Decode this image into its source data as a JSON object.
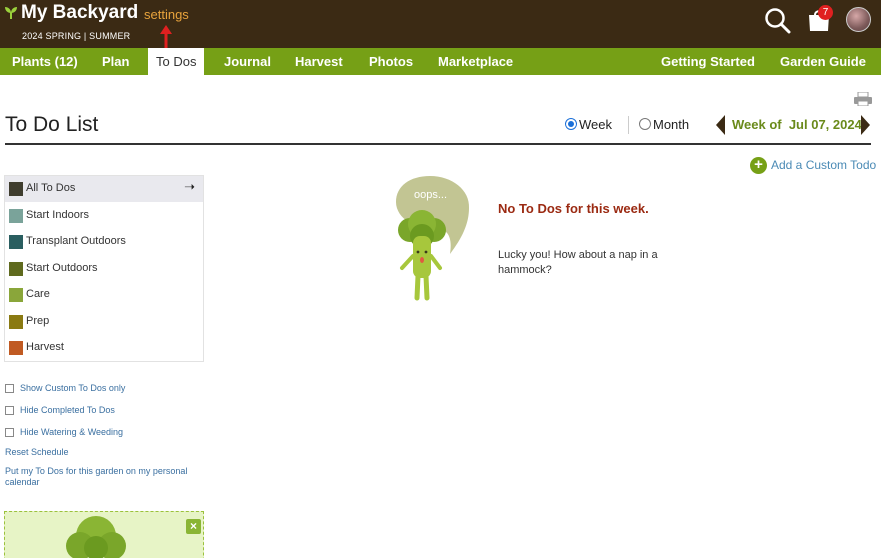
{
  "header": {
    "app_title": "My Backyard",
    "settings_label": "settings",
    "season": "2024 SPRING | SUMMER",
    "cart_count": "7",
    "icons": {
      "logo": "sprout-icon",
      "search": "search-icon",
      "cart": "shopping-bag-icon",
      "avatar": "user-avatar"
    }
  },
  "nav": {
    "items": [
      "Plants (12)",
      "Plan",
      "To Dos",
      "Journal",
      "Harvest",
      "Photos",
      "Marketplace"
    ],
    "right_items": [
      "Getting Started",
      "Garden Guide"
    ],
    "active": "To Dos"
  },
  "page": {
    "title": "To Do List",
    "view_options": [
      "Week",
      "Month"
    ],
    "selected_view": "Week",
    "week_label": "Week of  Jul 07, 2024",
    "add_custom_label": "Add a Custom Todo"
  },
  "categories": [
    {
      "label": "All To Dos",
      "color": "#3f3d2e"
    },
    {
      "label": "Start Indoors",
      "color": "#7aa39a"
    },
    {
      "label": "Transplant Outdoors",
      "color": "#2a5e60"
    },
    {
      "label": "Start Outdoors",
      "color": "#5f6a1e"
    },
    {
      "label": "Care",
      "color": "#8aa63a"
    },
    {
      "label": "Prep",
      "color": "#8a7a12"
    },
    {
      "label": "Harvest",
      "color": "#c05a22"
    }
  ],
  "options": {
    "show_custom": "Show Custom To Dos only",
    "hide_completed": "Hide Completed To Dos",
    "hide_watering": "Hide Watering & Weeding",
    "reset_schedule": "Reset Schedule",
    "calendar_link": "Put my To Dos for this garden on my personal calendar"
  },
  "empty_state": {
    "bubble_text": "oops...",
    "title": "No To Dos for this week.",
    "message": "Lucky you! How about a nap in a hammock?"
  },
  "colors": {
    "header_bg": "#3b2a14",
    "nav_bg": "#76a016",
    "accent_orange": "#e8a33c",
    "week_text": "#6a8a1a",
    "empty_title": "#9b2a12",
    "link_blue": "#3a6fa0",
    "badge_red": "#e02020"
  }
}
